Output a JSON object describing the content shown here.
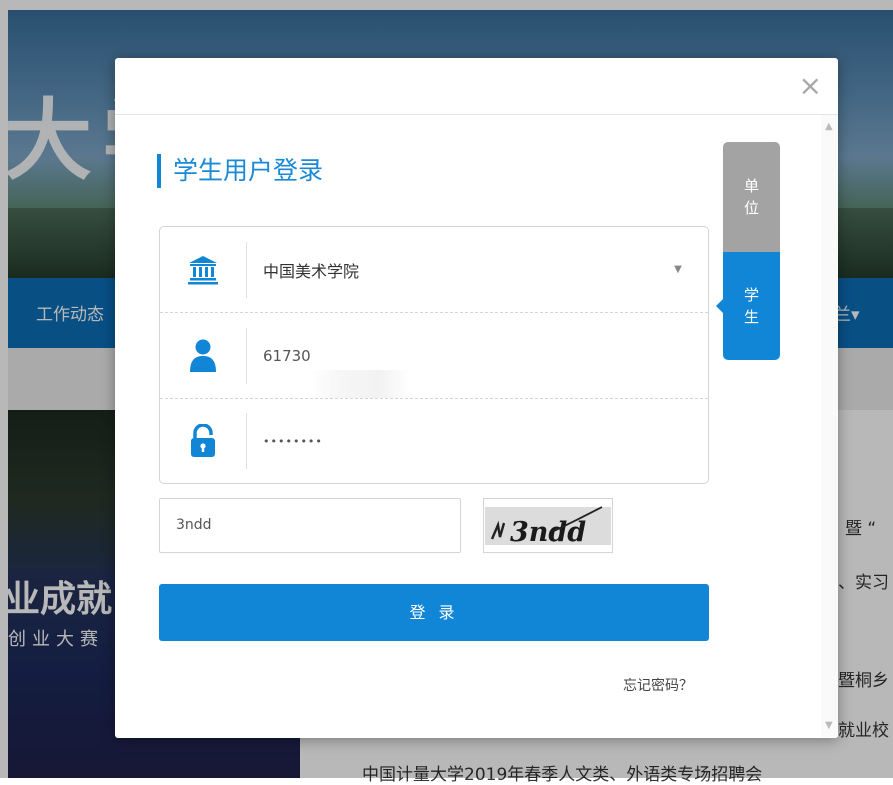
{
  "background": {
    "banner_text": "大学生就业创业",
    "nav_left": "工作动态",
    "nav_right": "兰▾",
    "photo_text": "业成就",
    "photo_subtext": "创业大赛",
    "article_lines": [
      "暨 “",
      "、实习",
      "暨桐乡",
      "就业校",
      "中国计量大学2019年春季人文类、外语类专场招聘会"
    ]
  },
  "modal": {
    "close_symbol": "×",
    "title": "学生用户登录",
    "tabs": {
      "unit": "单\n位",
      "student": "学\n生"
    },
    "school_select": {
      "value": "中国美术学院"
    },
    "username": {
      "value": "61730"
    },
    "password": {
      "value": "••••••••"
    },
    "captcha": {
      "value": "3ndd",
      "image_text": "3ndd"
    },
    "login_label": "登 录",
    "forgot_label": "忘记密码？"
  },
  "colors": {
    "accent": "#1186d6",
    "tab_inactive": "#a3a3a3",
    "nav": "#0c6eb8"
  }
}
